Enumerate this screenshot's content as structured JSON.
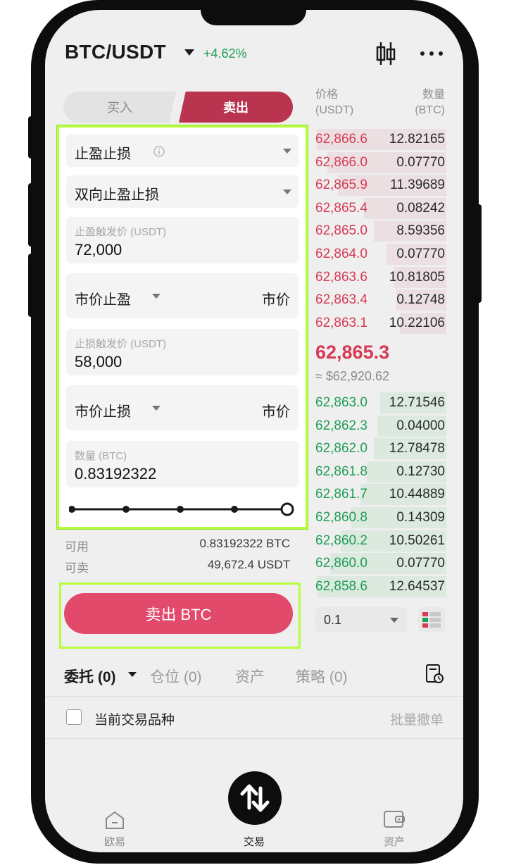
{
  "header": {
    "pair": "BTC/USDT",
    "change": "+4.62%"
  },
  "trade_tabs": {
    "buy": "买入",
    "sell": "卖出"
  },
  "form": {
    "order_type": "止盈止损",
    "sub_type": "双向止盈止损",
    "tp_trigger_label": "止盈触发价 (USDT)",
    "tp_trigger_value": "72,000",
    "tp_order_type": "市价止盈",
    "tp_price": "市价",
    "sl_trigger_label": "止损触发价 (USDT)",
    "sl_trigger_value": "58,000",
    "sl_order_type": "市价止损",
    "sl_price": "市价",
    "qty_label": "数量 (BTC)",
    "qty_value": "0.83192322",
    "slider_percent": 100
  },
  "balance": {
    "available_label": "可用",
    "available_value": "0.83192322 BTC",
    "sellable_label": "可卖",
    "sellable_value": "49,672.4 USDT"
  },
  "sell_button": "卖出 BTC",
  "orderbook": {
    "price_header": "价格",
    "price_unit": "(USDT)",
    "qty_header": "数量",
    "qty_unit": "(BTC)",
    "asks": [
      {
        "price": "62,866.6",
        "qty": "12.82165",
        "depth": 0.98
      },
      {
        "price": "62,866.0",
        "qty": "0.07770",
        "depth": 0.9
      },
      {
        "price": "62,865.9",
        "qty": "11.39689",
        "depth": 0.82
      },
      {
        "price": "62,865.4",
        "qty": "0.08242",
        "depth": 0.62
      },
      {
        "price": "62,865.0",
        "qty": "8.59356",
        "depth": 0.55
      },
      {
        "price": "62,864.0",
        "qty": "0.07770",
        "depth": 0.45
      },
      {
        "price": "62,863.6",
        "qty": "10.81805",
        "depth": 0.4
      },
      {
        "price": "62,863.4",
        "qty": "0.12748",
        "depth": 0.38
      },
      {
        "price": "62,863.1",
        "qty": "10.22106",
        "depth": 0.35
      }
    ],
    "mid_price": "62,865.3",
    "mid_fiat": "≈ $62,920.62",
    "bids": [
      {
        "price": "62,863.0",
        "qty": "12.71546",
        "depth": 0.5
      },
      {
        "price": "62,862.3",
        "qty": "0.04000",
        "depth": 0.52
      },
      {
        "price": "62,862.0",
        "qty": "12.78478",
        "depth": 0.55
      },
      {
        "price": "62,861.8",
        "qty": "0.12730",
        "depth": 0.6
      },
      {
        "price": "62,861.7",
        "qty": "10.44889",
        "depth": 0.65
      },
      {
        "price": "62,860.8",
        "qty": "0.14309",
        "depth": 0.72
      },
      {
        "price": "62,860.2",
        "qty": "10.50261",
        "depth": 0.8
      },
      {
        "price": "62,860.0",
        "qty": "0.07770",
        "depth": 0.88
      },
      {
        "price": "62,858.6",
        "qty": "12.64537",
        "depth": 0.98
      }
    ],
    "depth_step": "0.1"
  },
  "order_tabs": {
    "orders": "委托 (0)",
    "positions": "仓位 (0)",
    "assets": "资产",
    "strategy": "策略 (0)"
  },
  "filter": {
    "current_pair_only": "当前交易品种",
    "batch_cancel": "批量撤单"
  },
  "bottom_nav": {
    "home": "欧易",
    "trade": "交易",
    "assets": "资产"
  },
  "colors": {
    "accent_sell": "#e24a6c",
    "ask_red": "#d83a55",
    "bid_green": "#1f9e55",
    "highlight": "#b5ff3a"
  }
}
